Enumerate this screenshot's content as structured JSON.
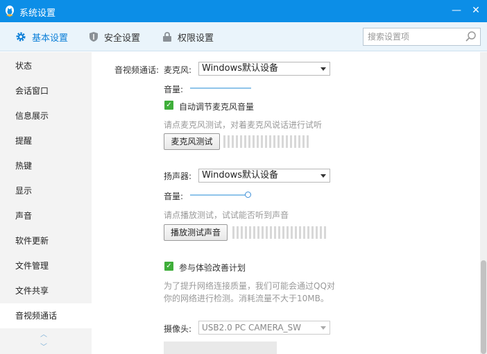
{
  "window": {
    "title": "系统设置",
    "minimize_label": "—",
    "close_label": "✕"
  },
  "tabs": [
    {
      "label": "基本设置",
      "icon": "gear-icon",
      "active": true
    },
    {
      "label": "安全设置",
      "icon": "shield-icon",
      "active": false
    },
    {
      "label": "权限设置",
      "icon": "lock-icon",
      "active": false
    }
  ],
  "search": {
    "placeholder": "搜索设置项",
    "value": ""
  },
  "sidebar": {
    "items": [
      {
        "label": "状态"
      },
      {
        "label": "会话窗口"
      },
      {
        "label": "信息展示"
      },
      {
        "label": "提醒"
      },
      {
        "label": "热键"
      },
      {
        "label": "显示"
      },
      {
        "label": "声音"
      },
      {
        "label": "软件更新"
      },
      {
        "label": "文件管理"
      },
      {
        "label": "文件共享"
      },
      {
        "label": "音视频通话",
        "active": true
      }
    ],
    "scroll_up": "︿",
    "scroll_down": "﹀"
  },
  "av": {
    "section_label": "音视频通话:",
    "mic": {
      "label": "麦克风:",
      "device": "Windows默认设备",
      "volume_label": "音量:",
      "auto_adjust_label": "自动调节麦克风音量",
      "auto_adjust_checked": true,
      "hint": "请点麦克风测试，对着麦克风说话进行试听",
      "test_button": "麦克风测试"
    },
    "speaker": {
      "label": "扬声器:",
      "device": "Windows默认设备",
      "volume_label": "音量:",
      "volume_level": 1.0,
      "hint": "请点播放测试，试试能否听到声音",
      "test_button": "播放测试声音"
    },
    "improve": {
      "label": "参与体验改善计划",
      "checked": true,
      "desc_line1": "为了提升网络连接质量，我们可能会通过QQ对",
      "desc_line2": "你的网络进行检测。消耗流量不大于10MB。"
    },
    "camera": {
      "label": "摄像头:",
      "device": "USB2.0 PC CAMERA_SW"
    }
  },
  "colors": {
    "titlebar": "#0c8ee7",
    "accent": "#0c7fd8",
    "check": "#3fae3a"
  }
}
